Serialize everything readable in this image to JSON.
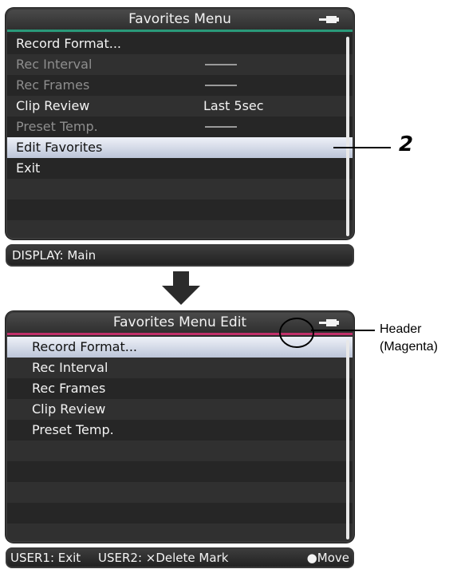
{
  "screen1": {
    "title": "Favorites Menu",
    "header_color": "#2a9a7a",
    "items": [
      {
        "label": "Record Format...",
        "value": "",
        "dim": false,
        "dash": false
      },
      {
        "label": "Rec Interval",
        "value": "",
        "dim": true,
        "dash": true
      },
      {
        "label": "Rec Frames",
        "value": "",
        "dim": true,
        "dash": true
      },
      {
        "label": "Clip Review",
        "value": "Last 5sec",
        "dim": false,
        "dash": false
      },
      {
        "label": "Preset Temp.",
        "value": "",
        "dim": true,
        "dash": true
      },
      {
        "label": "Edit Favorites",
        "value": "",
        "dim": false,
        "dash": false,
        "selected": true
      },
      {
        "label": "Exit",
        "value": "",
        "dim": false,
        "dash": false
      }
    ],
    "footer": "DISPLAY: Main",
    "callout": "2"
  },
  "screen2": {
    "title": "Favorites Menu Edit",
    "header_color": "#c0306a",
    "items": [
      {
        "label": "Record Format...",
        "selected": true
      },
      {
        "label": "Rec Interval"
      },
      {
        "label": "Rec Frames"
      },
      {
        "label": "Clip Review"
      },
      {
        "label": "Preset Temp."
      }
    ],
    "footer": {
      "user1": "USER1: Exit",
      "user2": "USER2: ×Delete Mark",
      "move": "●Move"
    },
    "callout_line1": "Header",
    "callout_line2": "(Magenta)"
  },
  "icons": {
    "battery": "battery-plug-icon",
    "arrow": "down-arrow-icon"
  }
}
